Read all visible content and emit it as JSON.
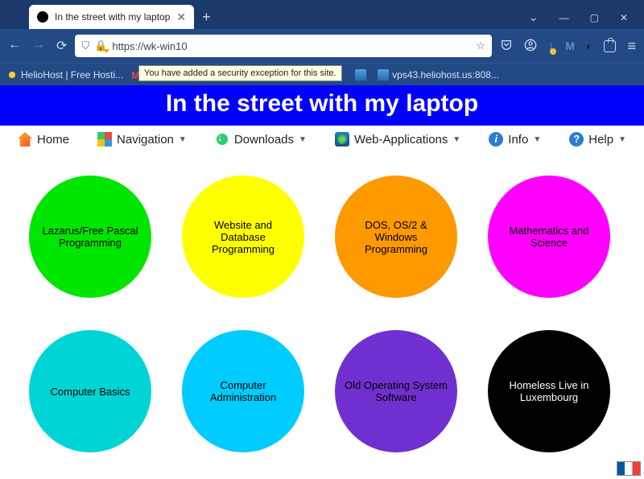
{
  "window": {
    "tab_title": "In the street with my laptop",
    "new_tab": "+",
    "controls": {
      "chevron": "⌄",
      "min": "—",
      "max": "▢",
      "close": "✕"
    }
  },
  "toolbar": {
    "back": "←",
    "forward": "→",
    "reload": "⟳",
    "shield": "⛉",
    "lock": "🔒",
    "url": "https://wk-win10",
    "star": "☆",
    "icons": {
      "pocket": "⌄",
      "account": "◯",
      "download": "↓",
      "mail": "M",
      "addon": "✦",
      "ext": "",
      "menu": "≡"
    }
  },
  "bookmarks": [
    {
      "label": "HelioHost | Free Hosti..."
    },
    {
      "label": ""
    },
    {
      "label": ""
    },
    {
      "label": "vps43.heliohost.us:808..."
    }
  ],
  "tooltip": "You have added a security exception for this site.",
  "banner": "In the street with my laptop",
  "menu": [
    {
      "label": "Home",
      "dropdown": false
    },
    {
      "label": "Navigation",
      "dropdown": true
    },
    {
      "label": "Downloads",
      "dropdown": true
    },
    {
      "label": "Web-Applications",
      "dropdown": true
    },
    {
      "label": "Info",
      "dropdown": true
    },
    {
      "label": "Help",
      "dropdown": true
    }
  ],
  "circles": [
    {
      "label": "Lazarus/Free Pascal Programming"
    },
    {
      "label": "Website and Database Programming"
    },
    {
      "label": "DOS, OS/2 & Windows Programming"
    },
    {
      "label": "Mathematics and Science"
    },
    {
      "label": "Computer Basics"
    },
    {
      "label": "Computer Administration"
    },
    {
      "label": "Old Operating System Software"
    },
    {
      "label": "Homeless Live in Luxembourg"
    }
  ]
}
